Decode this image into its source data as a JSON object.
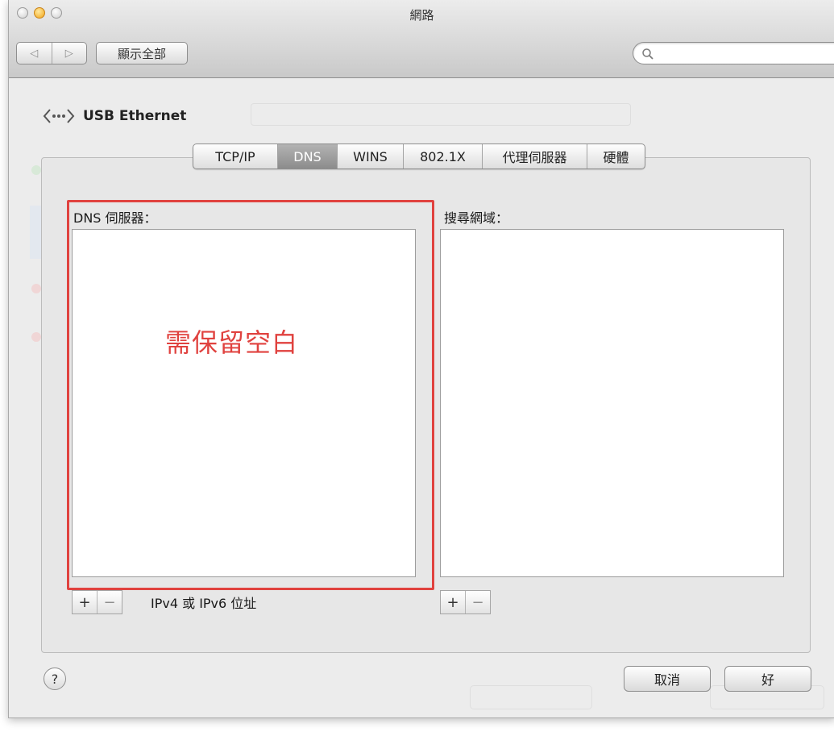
{
  "window": {
    "title": "網路"
  },
  "toolbar": {
    "back_label": "◁",
    "forward_label": "▷",
    "show_all_label": "顯示全部",
    "search_placeholder": ""
  },
  "interface": {
    "name": "USB Ethernet"
  },
  "tabs": [
    {
      "label": "TCP/IP",
      "active": false
    },
    {
      "label": "DNS",
      "active": true
    },
    {
      "label": "WINS",
      "active": false
    },
    {
      "label": "802.1X",
      "active": false
    },
    {
      "label": "代理伺服器",
      "active": false
    },
    {
      "label": "硬體",
      "active": false
    }
  ],
  "dns": {
    "servers_label": "DNS 伺服器：",
    "servers": [],
    "search_domains_label": "搜尋網域：",
    "search_domains": [],
    "address_hint": "IPv4 或 IPv6 位址",
    "annotation": "需保留空白"
  },
  "controls": {
    "add": "+",
    "remove": "−"
  },
  "footer": {
    "help": "?",
    "cancel_label": "取消",
    "ok_label": "好"
  },
  "colors": {
    "annotation": "#e0423f",
    "active_tab": "#9a9a9a"
  }
}
